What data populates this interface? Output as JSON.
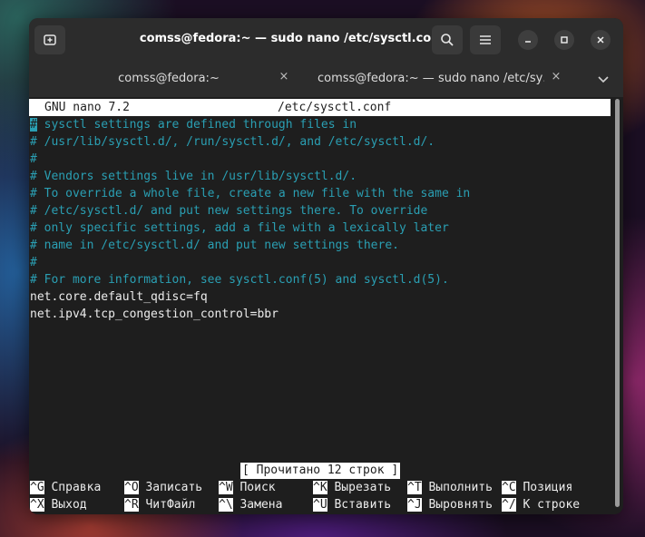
{
  "window": {
    "title": "comss@fedora:~ — sudo nano /etc/sysctl.conf"
  },
  "icons": {
    "new_tab": "new-tab-icon",
    "search": "search-icon",
    "menu": "hamburger-menu-icon",
    "minimize": "minimize-icon",
    "maximize": "maximize-icon",
    "close": "close-icon",
    "tab_close": "close-icon",
    "tab_dropdown": "chevron-down-icon"
  },
  "tabs": [
    {
      "label": "comss@fedora:~",
      "active": false,
      "close": "×"
    },
    {
      "label": "comss@fedora:~ — sudo nano /etc/sy…",
      "active": true,
      "close": "×"
    }
  ],
  "nano": {
    "version_label": "GNU nano 7.2",
    "filename": "/etc/sysctl.conf",
    "first_char": "#",
    "lines": [
      {
        "text": " sysctl settings are defined through files in",
        "type": "comment"
      },
      {
        "text": "# /usr/lib/sysctl.d/, /run/sysctl.d/, and /etc/sysctl.d/.",
        "type": "comment"
      },
      {
        "text": "#",
        "type": "comment"
      },
      {
        "text": "# Vendors settings live in /usr/lib/sysctl.d/.",
        "type": "comment"
      },
      {
        "text": "# To override a whole file, create a new file with the same in",
        "type": "comment"
      },
      {
        "text": "# /etc/sysctl.d/ and put new settings there. To override",
        "type": "comment"
      },
      {
        "text": "# only specific settings, add a file with a lexically later",
        "type": "comment"
      },
      {
        "text": "# name in /etc/sysctl.d/ and put new settings there.",
        "type": "comment"
      },
      {
        "text": "#",
        "type": "comment"
      },
      {
        "text": "# For more information, see sysctl.conf(5) and sysctl.d(5).",
        "type": "comment"
      },
      {
        "text": "net.core.default_qdisc=fq",
        "type": "setting"
      },
      {
        "text": "net.ipv4.tcp_congestion_control=bbr",
        "type": "setting"
      }
    ],
    "status": "[ Прочитано 12 строк ]",
    "shortcuts": [
      [
        {
          "key": "^G",
          "label": "Справка"
        },
        {
          "key": "^O",
          "label": "Записать"
        },
        {
          "key": "^W",
          "label": "Поиск"
        },
        {
          "key": "^K",
          "label": "Вырезать"
        },
        {
          "key": "^T",
          "label": "Выполнить"
        },
        {
          "key": "^C",
          "label": "Позиция"
        }
      ],
      [
        {
          "key": "^X",
          "label": "Выход"
        },
        {
          "key": "^R",
          "label": "ЧитФайл"
        },
        {
          "key": "^\\",
          "label": "Замена"
        },
        {
          "key": "^U",
          "label": "Вставить"
        },
        {
          "key": "^J",
          "label": "Выровнять"
        },
        {
          "key": "^/",
          "label": "К строке"
        }
      ]
    ]
  }
}
